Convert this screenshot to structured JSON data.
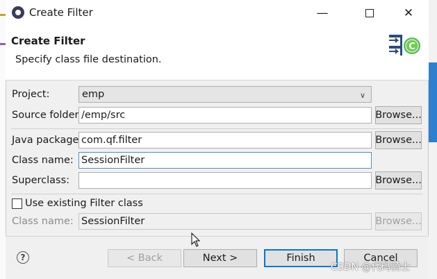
{
  "window": {
    "title": "Create Filter"
  },
  "banner": {
    "title": "Create Filter",
    "description": "Specify class file destination."
  },
  "form": {
    "project": {
      "label": "Project:",
      "value": "emp"
    },
    "source_folder": {
      "label": "Source folder:",
      "value": "/emp/src",
      "browse": "Browse..."
    },
    "java_package": {
      "label": "Java package:",
      "value": "com.qf.filter",
      "browse": "Browse..."
    },
    "class_name": {
      "label": "Class name:",
      "value": "SessionFilter"
    },
    "superclass": {
      "label": "Superclass:",
      "value": "",
      "browse": "Browse..."
    },
    "use_existing": {
      "label": "Use existing Filter class",
      "checked": false
    },
    "existing_class_name": {
      "label": "Class name:",
      "value": "SessionFilter",
      "browse": "Browse..."
    }
  },
  "footer": {
    "help": "?",
    "back": "< Back",
    "next": "Next >",
    "finish": "Finish",
    "cancel": "Cancel"
  },
  "watermark": "CSDN @代码骑士",
  "colors": {
    "focus_border": "#4a90c8",
    "primary_border": "#0078d7",
    "background_blue": "#2f7fd0"
  }
}
